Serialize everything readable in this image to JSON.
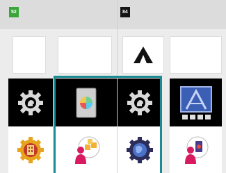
{
  "players": [
    {
      "number": "52",
      "badge_color": "#3aa63a"
    },
    {
      "number": "84",
      "badge_color": "#151515"
    }
  ],
  "highlight_color": "#1a8c92",
  "tiles": {
    "top_row": [
      "blank-card",
      "blank-card",
      "tent-icon",
      "blank-card"
    ],
    "black_row": [
      "gear-head-icon",
      "phone-rainbow-icon",
      "gear-head-icon",
      "portal-frame-icon"
    ],
    "bottom_row": [
      "gear-building-icon",
      "person-boxes-icon",
      "gear-globe-icon",
      "person-phone-icon"
    ]
  }
}
